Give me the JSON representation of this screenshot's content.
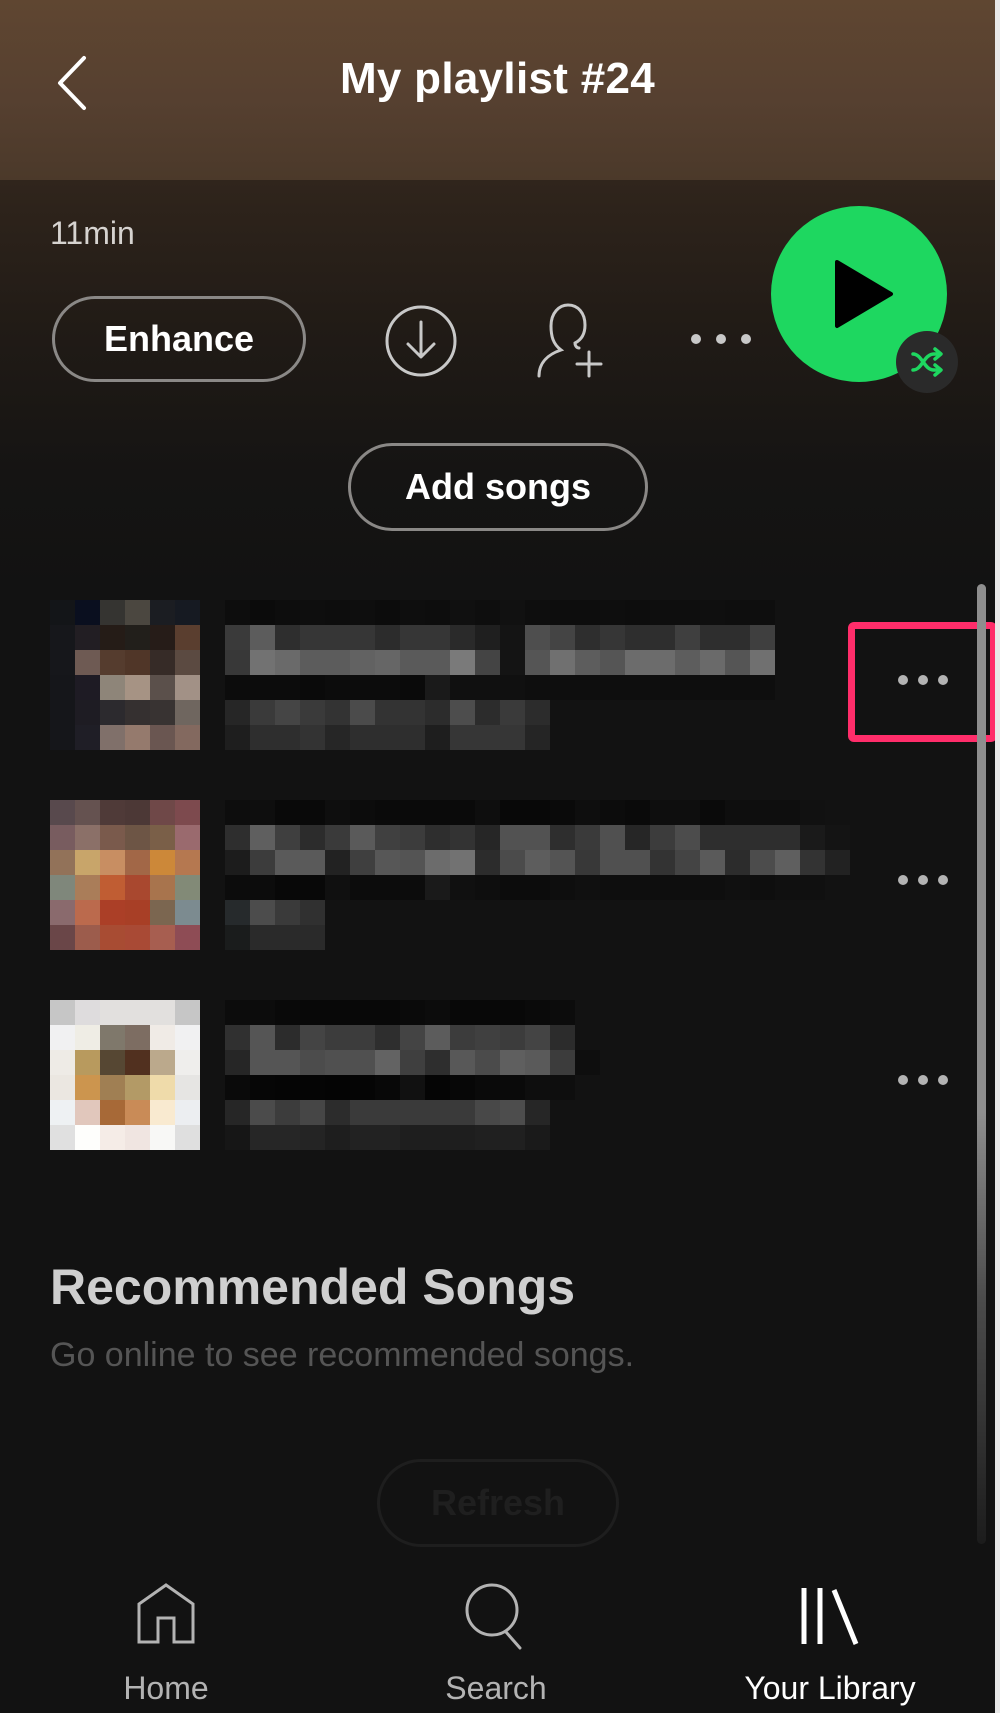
{
  "header": {
    "title": "My playlist #24",
    "back_icon": "chevron-left-icon"
  },
  "playlist": {
    "duration": "11min",
    "enhance_label": "Enhance",
    "add_songs_label": "Add songs",
    "actions": [
      {
        "name": "download",
        "icon": "download-circle-icon"
      },
      {
        "name": "add-collaborator",
        "icon": "add-user-icon"
      },
      {
        "name": "more-options",
        "icon": "more-horizontal-icon"
      }
    ],
    "play_icon": "play-icon",
    "shuffle_icon": "shuffle-icon",
    "accent_color": "#1ed760"
  },
  "tracks": [
    {
      "title_redacted": true,
      "more_icon": "more-horizontal-icon",
      "highlighted": true,
      "art": [
        [
          "#131518",
          "#0a0f1f",
          "#353431",
          "#4b4740",
          "#1b1d22",
          "#161a22"
        ],
        [
          "#16171b",
          "#221e23",
          "#251c17",
          "#221f1b",
          "#261c18",
          "#5a3e2f"
        ],
        [
          "#16171b",
          "#6e5a53",
          "#553c2e",
          "#503628",
          "#362b27",
          "#5b4a41"
        ],
        [
          "#15161a",
          "#1e1b24",
          "#8e8579",
          "#a69384",
          "#5b504b",
          "#a29186"
        ],
        [
          "#15161a",
          "#1e1c23",
          "#2c2a2e",
          "#353030",
          "#383332",
          "#6f665f"
        ],
        [
          "#15161a",
          "#1f1e26",
          "#80706a",
          "#957a6d",
          "#6a5651",
          "#83695f"
        ]
      ],
      "text_rows": [
        [
          "#0d0d0d",
          "#0b0b0b",
          "#0d0d0d",
          "#0e0e0e",
          "#0d0d0d",
          "#0e0e0e",
          "#0c0c0c",
          "#0e0e0e",
          "#0d0d0d",
          "#101010",
          "#0e0e0e",
          "#111",
          "#0e0e0e",
          "#0d0d0d",
          "#0d0d0d",
          "#0e0e0e",
          "#0d0d0d",
          "#0e0e0e",
          "#0e0e0e",
          "#0f0f0f",
          "#0e0e0e",
          "#0e0e0e"
        ],
        [
          "#3a3a3a",
          "#5c5c5c",
          "#2e2e2e",
          "#363636",
          "#363636",
          "#363636",
          "#2c2c2c",
          "#363636",
          "#363636",
          "#2a2a2a",
          "#1f1f1f",
          "#141414",
          "#4e4e4e",
          "#444",
          "#2e2e2e",
          "#363636",
          "#2e2e2e",
          "#2e2e2e",
          "#3f3f3f",
          "#2e2e2e",
          "#2e2e2e",
          "#3f3f3f"
        ],
        [
          "#383838",
          "#727272",
          "#6a6a6a",
          "#5c5c5c",
          "#5c5c5c",
          "#626262",
          "#666666",
          "#5a5a5a",
          "#5a5a5a",
          "#7a7a7a",
          "#444",
          "#141414",
          "#555",
          "#707070",
          "#5d5d5d",
          "#555",
          "#6c6c6c",
          "#6c6c6c",
          "#5d5d5d",
          "#6a6a6a",
          "#555",
          "#707070"
        ],
        [
          "#0c0c0c",
          "#0c0c0c",
          "#0c0c0c",
          "#0a0a0a",
          "#0c0c0c",
          "#0c0c0c",
          "#0c0c0c",
          "#0a0a0a",
          "#1a1a1a",
          "#101010",
          "#101010",
          "#101010",
          "#0e0e0e",
          "#0e0e0e",
          "#0e0e0e",
          "#0e0e0e",
          "#0e0e0e",
          "#0e0e0e",
          "#0e0e0e",
          "#0e0e0e",
          "#0e0e0e",
          "#0e0e0e"
        ],
        [
          "#262626",
          "#3a3a3a",
          "#454545",
          "#3a3a3a",
          "#333",
          "#4b4b4b",
          "#333",
          "#333",
          "#2c2c2c",
          "#4d4d4d",
          "#2c2c2c",
          "#3a3a3a",
          "#2c2c2c",
          "#121212"
        ],
        [
          "#1e1e1e",
          "#2e2e2e",
          "#2e2e2e",
          "#333",
          "#262626",
          "#2e2e2e",
          "#2e2e2e",
          "#2e2e2e",
          "#1e1e1e",
          "#363636",
          "#363636",
          "#363636",
          "#252525",
          "#121212"
        ]
      ]
    },
    {
      "title_redacted": true,
      "more_icon": "more-horizontal-icon",
      "highlighted": false,
      "art": [
        [
          "#58494d",
          "#655250",
          "#4f3a38",
          "#4c3836",
          "#6f4848",
          "#7d4a4e"
        ],
        [
          "#785c5f",
          "#8b7068",
          "#7a5a4c",
          "#6d5545",
          "#7a5f48",
          "#9a6a6e"
        ],
        [
          "#927259",
          "#c8a56a",
          "#c88e62",
          "#a26747",
          "#cc8839",
          "#b57850"
        ],
        [
          "#7f877b",
          "#aa7d59",
          "#c05d33",
          "#a9482f",
          "#a8744d",
          "#828a77"
        ],
        [
          "#8a6a6d",
          "#bb6a4d",
          "#ab3f27",
          "#a83f26",
          "#7b6650",
          "#7c8b90"
        ],
        [
          "#6a4648",
          "#9c5c4c",
          "#a84c33",
          "#a94a35",
          "#a75e50",
          "#8e4c55"
        ]
      ],
      "text_rows": [
        [
          "#0d0d0d",
          "#0e0e0e",
          "#090909",
          "#090909",
          "#0e0e0e",
          "#0c0c0c",
          "#0a0a0a",
          "#0a0a0a",
          "#0a0a0a",
          "#0a0a0a",
          "#0e0e0e",
          "#080808",
          "#080808",
          "#0a0a0a",
          "#0e0e0e",
          "#0c0c0c",
          "#0a0a0a",
          "#0e0e0e",
          "#0e0e0e",
          "#0a0a0a",
          "#0e0e0e",
          "#0e0e0e",
          "#0e0e0e",
          "#111",
          "#121212"
        ],
        [
          "#2e2e2e",
          "#5f5f5f",
          "#3f3f3f",
          "#2c2c2c",
          "#3a3a3a",
          "#5a5a5a",
          "#404040",
          "#3c3c3c",
          "#2e2e2e",
          "#333",
          "#262626",
          "#525252",
          "#525252",
          "#2e2e2e",
          "#3a3a3a",
          "#505050",
          "#262626",
          "#3c3c3c",
          "#4c4c4c",
          "#2e2e2e",
          "#2e2e2e",
          "#2e2e2e",
          "#2e2e2e",
          "#1a1a1a",
          "#141414"
        ],
        [
          "#1c1c1c",
          "#3c3c3c",
          "#5a5a5a",
          "#5a5a5a",
          "#222",
          "#3f3f3f",
          "#575757",
          "#545454",
          "#6c6c6c",
          "#727272",
          "#2c2c2c",
          "#4b4b4b",
          "#5d5d5d",
          "#545454",
          "#383838",
          "#505050",
          "#505050",
          "#333",
          "#444",
          "#5a5a5a",
          "#2c2c2c",
          "#4c4c4c",
          "#5f5f5f",
          "#333",
          "#222"
        ],
        [
          "#0c0c0c",
          "#0c0c0c",
          "#080808",
          "#080808",
          "#101010",
          "#0c0c0c",
          "#0c0c0c",
          "#0c0c0c",
          "#1a1a1a",
          "#101010",
          "#0e0e0e",
          "#0c0c0c",
          "#0c0c0c",
          "#0e0e0e",
          "#101010",
          "#0e0e0e",
          "#0e0e0e",
          "#0e0e0e",
          "#0e0e0e",
          "#0e0e0e",
          "#101010",
          "#0e0e0e",
          "#101010",
          "#101010",
          "#121212"
        ],
        [
          "#262a2c",
          "#4c4c4c",
          "#3a3a3a",
          "#303030"
        ],
        [
          "#1a1c1c",
          "#2a2a2a",
          "#2a2a2a",
          "#2a2a2a"
        ]
      ]
    },
    {
      "title_redacted": true,
      "more_icon": "more-horizontal-icon",
      "highlighted": false,
      "art": [
        [
          "#c6c6c6",
          "#dedcdd",
          "#e2e0de",
          "#e2e0de",
          "#e2e0de",
          "#c6c6c6"
        ],
        [
          "#f1f1f2",
          "#efede5",
          "#7f786b",
          "#7d6d62",
          "#f0ebe6",
          "#f1f1f2"
        ],
        [
          "#eeebe6",
          "#b89a5e",
          "#564733",
          "#51301f",
          "#bba98c",
          "#efeeec"
        ],
        [
          "#ebe7e1",
          "#cc954e",
          "#a07f53",
          "#b39a66",
          "#efdbaa",
          "#e6e5e3"
        ],
        [
          "#eef1f3",
          "#e1c7bc",
          "#a76937",
          "#c98b57",
          "#f9ead0",
          "#eceef1"
        ],
        [
          "#e0e0e0",
          "#fefefc",
          "#f5ece7",
          "#f0e5e1",
          "#f8f8f6",
          "#dfdfdf"
        ]
      ],
      "text_rows": [
        [
          "#0c0c0c",
          "#0c0c0c",
          "#090909",
          "#080808",
          "#080808",
          "#080808",
          "#080808",
          "#0a0a0a",
          "#0c0c0c",
          "#080808",
          "#080808",
          "#080808",
          "#0a0a0a",
          "#0c0c0c",
          "#121212"
        ],
        [
          "#303030",
          "#555",
          "#2c2c2c",
          "#444",
          "#3c3c3c",
          "#3c3c3c",
          "#2e2e2e",
          "#444",
          "#5c5c5c",
          "#3c3c3c",
          "#404040",
          "#3c3c3c",
          "#444",
          "#2c2c2c",
          "#121212"
        ],
        [
          "#262626",
          "#555",
          "#555",
          "#4c4c4c",
          "#505050",
          "#505050",
          "#636363",
          "#3f3f3f",
          "#2e2e2e",
          "#585858",
          "#4b4b4b",
          "#5f5f5f",
          "#5a5a5a",
          "#3c3c3c",
          "#0e0e0e"
        ],
        [
          "#0a0a0a",
          "#060606",
          "#050505",
          "#050505",
          "#040404",
          "#050505",
          "#080808",
          "#111",
          "#050505",
          "#070707",
          "#0a0a0a",
          "#0a0a0a",
          "#0e0e0e",
          "#0e0e0e",
          "#121212"
        ],
        [
          "#262626",
          "#4b4b4b",
          "#3c3c3c",
          "#464646",
          "#2c2c2c",
          "#3a3a3a",
          "#3a3a3a",
          "#3a3a3a",
          "#3a3a3a",
          "#3a3a3a",
          "#484848",
          "#4d4d4d",
          "#262626"
        ],
        [
          "#161616",
          "#262626",
          "#262626",
          "#242424",
          "#1e1e1e",
          "#222",
          "#222",
          "#1e1e1e",
          "#1e1e1e",
          "#1e1e1e",
          "#202020",
          "#202020",
          "#1a1a1a"
        ]
      ]
    }
  ],
  "recommended": {
    "title": "Recommended Songs",
    "subtitle": "Go online to see recommended songs.",
    "refresh_label": "Refresh"
  },
  "highlight_color": "#ff2d6a",
  "bottom_nav": {
    "items": [
      {
        "label": "Home",
        "icon": "home-icon",
        "active": false
      },
      {
        "label": "Search",
        "icon": "search-icon",
        "active": false
      },
      {
        "label": "Your Library",
        "icon": "library-icon",
        "active": true
      }
    ]
  }
}
